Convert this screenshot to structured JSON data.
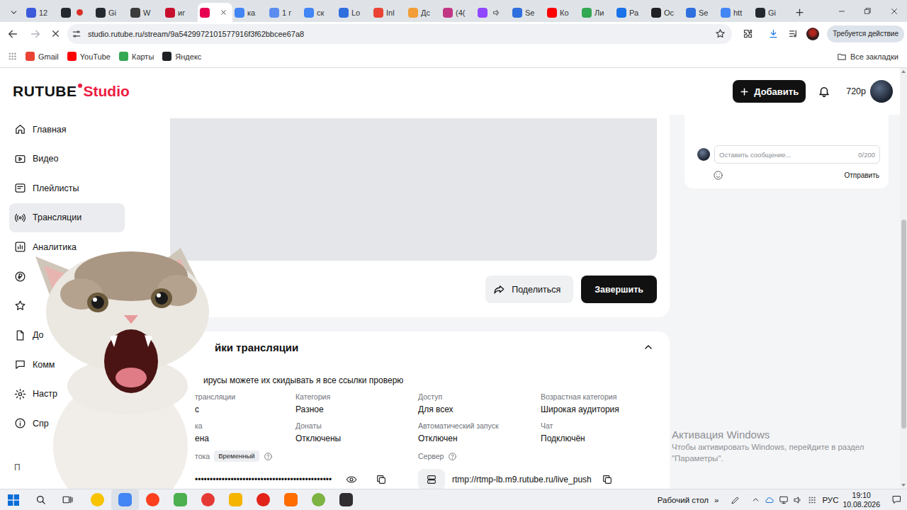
{
  "browser": {
    "tabs": [
      {
        "label": "12",
        "selected": false,
        "kind": "plain",
        "color": "#3b5bdb"
      },
      {
        "selected": false,
        "kind": "recording",
        "color": "#24292f"
      },
      {
        "label": "Gi",
        "selected": false,
        "kind": "plain",
        "color": "#24292f"
      },
      {
        "label": "W",
        "selected": false,
        "kind": "plain",
        "color": "#3c3c3c"
      },
      {
        "label": "иг",
        "selected": false,
        "kind": "plain",
        "color": "#c8102e"
      },
      {
        "selected": true,
        "kind": "plain",
        "color": "#e60050"
      },
      {
        "label": "ка",
        "selected": false,
        "kind": "plain",
        "color": "#4285f4"
      },
      {
        "label": "1 г",
        "selected": false,
        "kind": "plain",
        "color": "#5b8def"
      },
      {
        "label": "ск",
        "selected": false,
        "kind": "plain",
        "color": "#4285f4"
      },
      {
        "label": "Lo",
        "selected": false,
        "kind": "plain",
        "color": "#2f6fde"
      },
      {
        "label": "Inl",
        "selected": false,
        "kind": "plain",
        "color": "#ea4335"
      },
      {
        "label": "Дс",
        "selected": false,
        "kind": "plain",
        "color": "#f29d38"
      },
      {
        "label": "(4(",
        "selected": false,
        "kind": "plain",
        "color": "#c13584"
      },
      {
        "selected": false,
        "kind": "audio",
        "color": "#9146ff"
      },
      {
        "label": "Se",
        "selected": false,
        "kind": "plain",
        "color": "#2f6fde"
      },
      {
        "label": "Ко",
        "selected": false,
        "kind": "plain",
        "color": "#ff0000"
      },
      {
        "label": "Ли",
        "selected": false,
        "kind": "plain",
        "color": "#34a853"
      },
      {
        "label": "Ра",
        "selected": false,
        "kind": "plain",
        "color": "#1a73e8"
      },
      {
        "label": "Ос",
        "selected": false,
        "kind": "plain",
        "color": "#202124"
      },
      {
        "label": "Se",
        "selected": false,
        "kind": "plain",
        "color": "#2f6fde"
      },
      {
        "label": "htt",
        "selected": false,
        "kind": "plain",
        "color": "#4285f4"
      },
      {
        "label": "Gi",
        "selected": false,
        "kind": "plain",
        "color": "#24292f"
      }
    ],
    "loading": true,
    "url": "studio.rutube.ru/stream/9a5429972101577916f3f62bbcee67a8",
    "bookmarked": false,
    "action_button": "Требуется действие",
    "bookmarks": [
      {
        "label": "Gmail",
        "color": "#ea4335"
      },
      {
        "label": "YouTube",
        "color": "#ff0000"
      },
      {
        "label": "Карты",
        "color": "#34a853"
      },
      {
        "label": "Яндекс",
        "color": "#202124"
      }
    ],
    "all_bookmarks": "Все закладки"
  },
  "header": {
    "logo": "RUTUBE",
    "logo_suffix": "Studio",
    "add_button": "Добавить",
    "quality": "720р"
  },
  "sidebar": {
    "items": [
      {
        "label": "Главная",
        "selected": false,
        "kind": "text"
      },
      {
        "label": "Видео",
        "selected": false,
        "kind": "text"
      },
      {
        "label": "Плейлисты",
        "selected": false,
        "kind": "text"
      },
      {
        "label": "Трансляции",
        "selected": true,
        "kind": "text"
      },
      {
        "label": "Аналитика",
        "selected": false,
        "kind": "text"
      },
      {
        "selected": false,
        "kind": "icon"
      },
      {
        "selected": false,
        "kind": "icon"
      },
      {
        "label": "До",
        "selected": false,
        "kind": "text"
      },
      {
        "label": "Комм",
        "selected": false,
        "kind": "text"
      },
      {
        "label": "Настр",
        "selected": false,
        "kind": "text"
      },
      {
        "label": "Спр",
        "selected": false,
        "kind": "text"
      }
    ],
    "footer": "П"
  },
  "stream": {
    "share_button": "Поделиться",
    "end_button": "Завершить"
  },
  "chat": {
    "placeholder": "Оставить сообщение...",
    "counter": "0/200",
    "send": "Отправить"
  },
  "settings": {
    "title": "йки трансляции",
    "expanded": true,
    "description": "ирусы можете их скидывать я все ссылки проверю",
    "fields": [
      {
        "label": "трансляции",
        "value": "с"
      },
      {
        "label": "Категория",
        "value": "Разное"
      },
      {
        "label": "Доступ",
        "value": "Для всех"
      },
      {
        "label": "Возрастная категория",
        "value": "Широкая аудитория"
      },
      {
        "label": "ка",
        "value": "ена"
      },
      {
        "label": "Донаты",
        "value": "Отключены"
      },
      {
        "label": "Автоматический запуск",
        "value": "Отключен"
      },
      {
        "label": "Чат",
        "value": "Подключён"
      }
    ],
    "key": {
      "label": "тока",
      "badge": "Временный",
      "value": "••••••••••••••••••••••••••••••••••••••••••••••"
    },
    "server": {
      "label": "Сервер",
      "value": "rtmp://rtmp-lb.m9.rutube.ru/live_push"
    }
  },
  "watermark": {
    "title": "Активация Windows",
    "line1": "Чтобы активировать Windows, перейдите в раздел",
    "line2": "\"Параметры\"."
  },
  "taskbar": {
    "apps": [
      {
        "color": "#f8c300",
        "active": false
      },
      {
        "color": "#4285f4",
        "active": true
      },
      {
        "color": "#fc3f1d",
        "active": false
      },
      {
        "color": "#4caf50",
        "active": false
      },
      {
        "color": "#e53935",
        "active": false
      },
      {
        "color": "#f4b400",
        "active": false
      },
      {
        "color": "#e2231a",
        "active": false
      },
      {
        "color": "#ff6d00",
        "active": false
      },
      {
        "color": "#7cb342",
        "active": false
      },
      {
        "color": "#302e31",
        "active": false
      }
    ],
    "desktop": "Рабочий стол",
    "overflow": "»",
    "lang": "РУС",
    "time": "19:10",
    "date": "10.08.2026"
  }
}
